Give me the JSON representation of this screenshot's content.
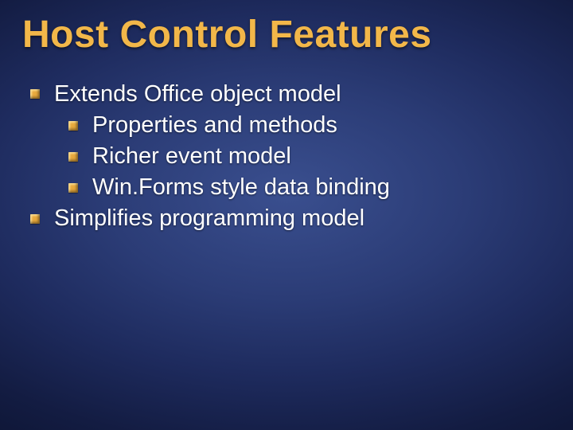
{
  "title": "Host Control Features",
  "bullets": {
    "b0": "Extends Office object model",
    "b1": "Properties and methods",
    "b2": "Richer event model",
    "b3": "Win.Forms style data binding",
    "b4": "Simplifies programming model"
  }
}
